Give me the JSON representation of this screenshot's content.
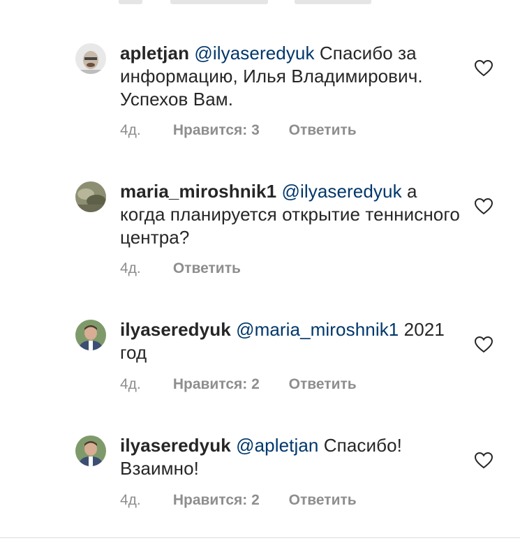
{
  "comments": [
    {
      "username": "apletjan",
      "mention": "@ilyaseredyuk",
      "text": " Спасибо за информацию, Илья Владимирович. Успехов Вам.",
      "age": "4д.",
      "likes": "Нравится: 3",
      "reply": "Ответить"
    },
    {
      "username": "maria_miroshnik1",
      "mention": "@ilyaseredyuk",
      "text": " а когда планируется открытие теннисного центра?",
      "age": "4д.",
      "likes": "",
      "reply": "Ответить"
    },
    {
      "username": "ilyaseredyuk",
      "mention": "@maria_miroshnik1",
      "text": " 2021 год",
      "age": "4д.",
      "likes": "Нравится: 2",
      "reply": "Ответить"
    },
    {
      "username": "ilyaseredyuk",
      "mention": "@apletjan",
      "text": " Спасибо! Взаимно!",
      "age": "4д.",
      "likes": "Нравится: 2",
      "reply": "Ответить"
    }
  ],
  "icons": {
    "like": "heart-outline-icon"
  },
  "colors": {
    "text": "#262626",
    "mention": "#00376b",
    "meta": "#8e8e8e"
  }
}
